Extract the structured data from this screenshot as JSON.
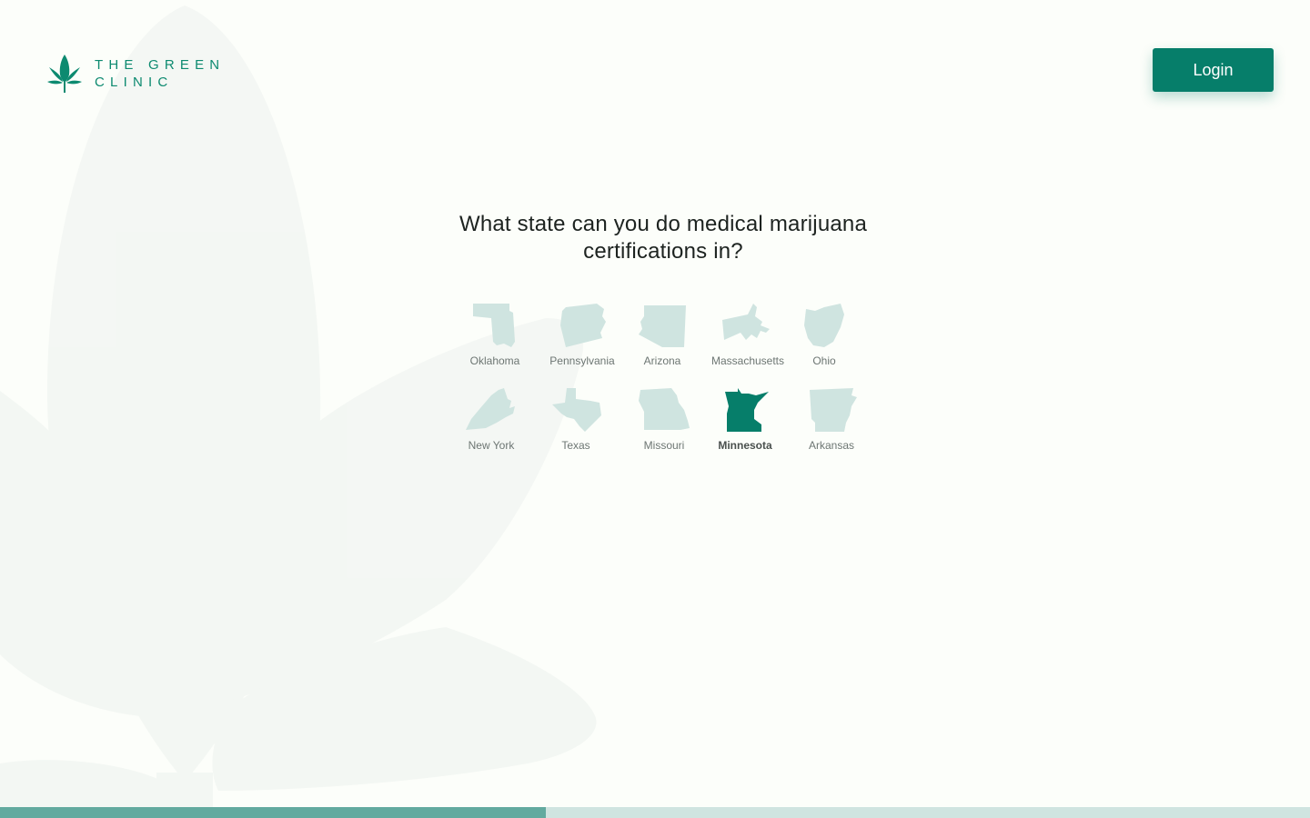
{
  "brand": {
    "name_line1": "THE GREEN",
    "name_line2": "CLINIC",
    "icon": "cannabis-leaf-icon",
    "color": "#0d8a70"
  },
  "header": {
    "login_label": "Login"
  },
  "question": {
    "text": "What state can you do medical marijuana certifications in?"
  },
  "states": [
    {
      "label": "Oklahoma",
      "icon": "oklahoma-map-icon",
      "selected": false
    },
    {
      "label": "Pennsylvania",
      "icon": "pennsylvania-map-icon",
      "selected": false
    },
    {
      "label": "Arizona",
      "icon": "arizona-map-icon",
      "selected": false
    },
    {
      "label": "Massachusetts",
      "icon": "massachusetts-map-icon",
      "selected": false
    },
    {
      "label": "Ohio",
      "icon": "ohio-map-icon",
      "selected": false
    },
    {
      "label": "New York",
      "icon": "new-york-map-icon",
      "selected": false
    },
    {
      "label": "Texas",
      "icon": "texas-map-icon",
      "selected": false
    },
    {
      "label": "Missouri",
      "icon": "missouri-map-icon",
      "selected": false
    },
    {
      "label": "Minnesota",
      "icon": "minnesota-map-icon",
      "selected": true
    },
    {
      "label": "Arkansas",
      "icon": "arkansas-map-icon",
      "selected": false
    }
  ],
  "progress": {
    "fraction": 0.4167
  },
  "colors": {
    "accent": "#067e6a",
    "state_default": "#cfe4e0",
    "state_selected": "#067e6a",
    "progress_fill": "#62aa9f",
    "progress_track": "#cfe4e0",
    "background": "#fcfefa"
  }
}
